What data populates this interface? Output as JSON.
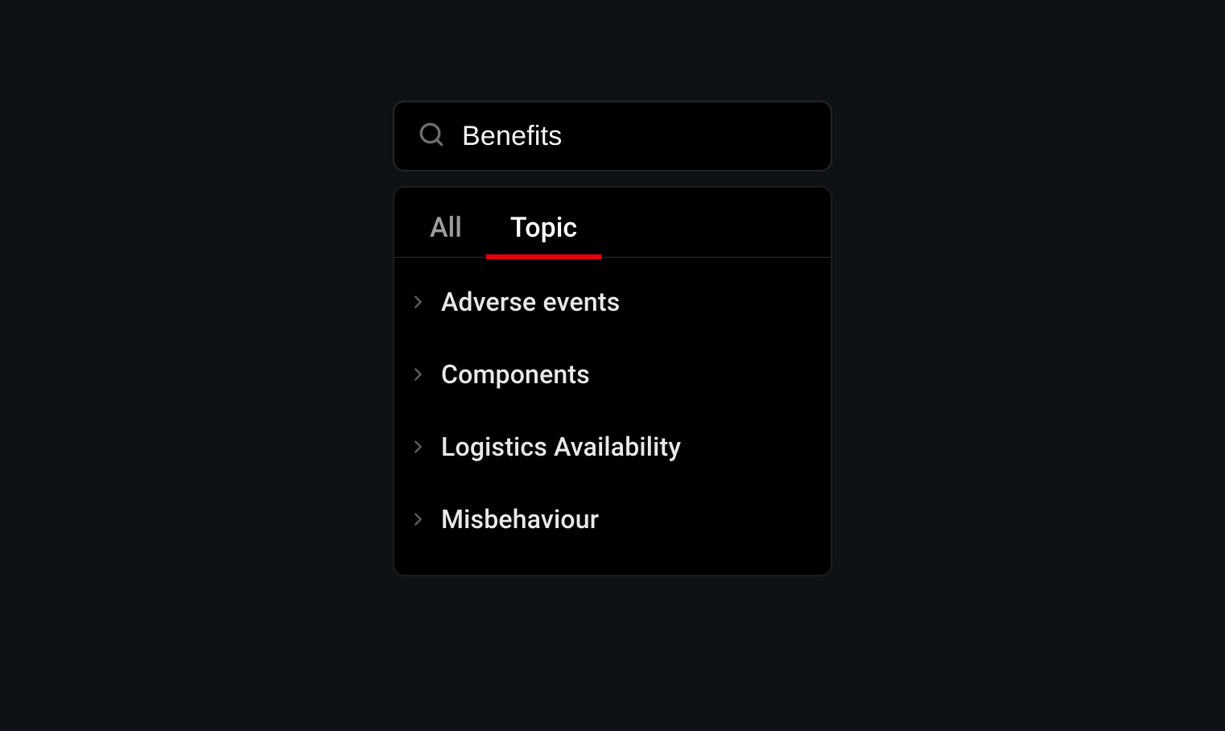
{
  "search": {
    "value": "Benefits",
    "placeholder": ""
  },
  "tabs": [
    {
      "label": "All",
      "active": false
    },
    {
      "label": "Topic",
      "active": true
    }
  ],
  "results": [
    {
      "label": "Adverse events"
    },
    {
      "label": "Components"
    },
    {
      "label": "Logistics Availability"
    },
    {
      "label": "Misbehaviour"
    }
  ],
  "colors": {
    "accent": "#e6000d",
    "background": "#0e1116",
    "panel": "#000000",
    "border": "#232629"
  }
}
